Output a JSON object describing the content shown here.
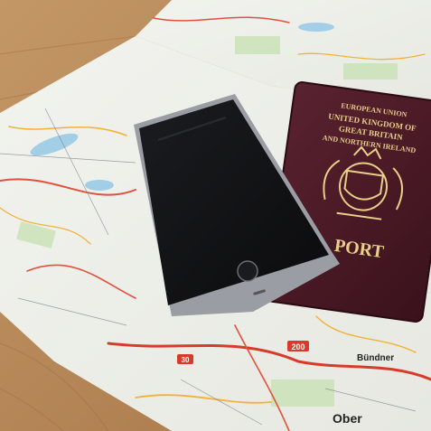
{
  "scene": {
    "description_role": "photo of a road map with a smartphone and passport",
    "colors": {
      "table": "#b98c5a",
      "map_paper": "#eef0e8",
      "phone_body": "#9a9ea4",
      "phone_screen": "#111214",
      "passport_cover": "#4a1a24",
      "gold_foil": "#e8cf8a"
    }
  },
  "passport": {
    "line1": "EUROPEAN UNION",
    "line2": "UNITED KINGDOM OF",
    "line3": "GREAT BRITAIN",
    "line4": "AND NORTHERN IRELAND",
    "word": "PORT",
    "crest_icon": "royal-coat-of-arms-icon"
  },
  "phone": {
    "home_button_icon": "home-button-icon"
  },
  "map_labels": {
    "route_number_1": "200",
    "route_number_2": "30",
    "place_1": "Bündner",
    "place_2": "Ober"
  }
}
